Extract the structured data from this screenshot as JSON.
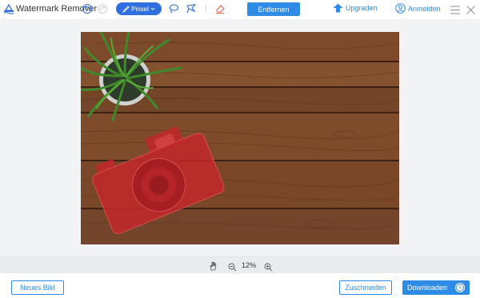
{
  "app": {
    "title": "Watermark Remover"
  },
  "toolbar": {
    "brush_label": "Pinsel",
    "remove_label": "Entfernen",
    "upgrade_label": "Upgraden",
    "login_label": "Anmelden"
  },
  "zoom": {
    "level": "12%"
  },
  "footer": {
    "new_image_label": "Neues Bild",
    "crop_label": "Zuschneiden",
    "download_label": "Downloaden"
  },
  "colors": {
    "accent": "#2f8ce6",
    "brush_accent": "#2f6fe0",
    "selection_mask": "#c0282a"
  },
  "icons": [
    "logo-icon",
    "undo-icon",
    "redo-icon",
    "brush-icon",
    "lasso-icon",
    "polygon-lasso-icon",
    "eraser-icon",
    "upgrade-icon",
    "user-icon",
    "menu-icon",
    "close-icon",
    "hand-icon",
    "zoom-out-icon",
    "zoom-in-icon",
    "clock-icon"
  ]
}
